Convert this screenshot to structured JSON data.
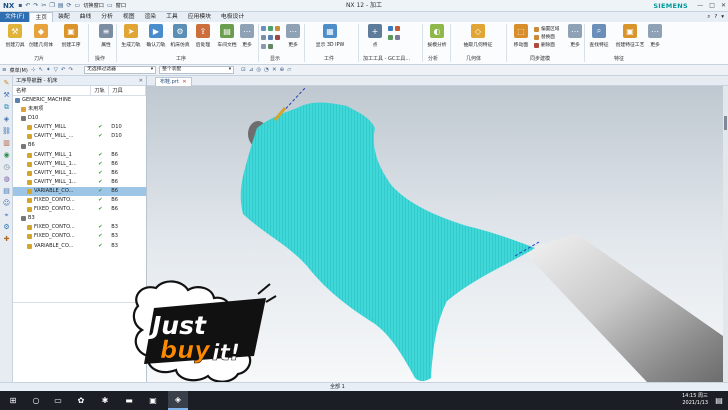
{
  "window": {
    "app_logo": "NX",
    "title": "NX 12 - 加工",
    "brand": "SIEMENS",
    "switch_window": "切换窗口",
    "window_menu": "窗口",
    "minimize": "—",
    "maximize": "□",
    "close": "✕"
  },
  "ribbon_tabs": [
    "文件(F)",
    "主页",
    "装配",
    "曲线",
    "分析",
    "视图",
    "渲染",
    "工具",
    "应用模块",
    "电极设计"
  ],
  "ribbon_groups": {
    "tool": "刀片",
    "operation": "操作",
    "process": "工序",
    "display": "显示",
    "workpiece": "工件",
    "machining_tool": "加工工具 - GC工具...",
    "analysis": "分析",
    "geometry": "几何体",
    "sync_modeling": "同步建模",
    "feature": "特征"
  },
  "ribbon_buttons": {
    "create_tool": "创建刀具",
    "create_geometry": "创建几何体",
    "create_operation": "创建工序",
    "properties": "属性",
    "generate_path": "生成刀轨",
    "confirm_path": "确认刀轨",
    "machine_sim": "机床仿真",
    "postprocess": "后处理",
    "shop_doc": "车间文档",
    "more1": "更多",
    "more2": "更多",
    "display_3d_ipw": "显示 3D IPW",
    "point": "点",
    "draft_analysis": "拔模分析",
    "extract_geometry": "抽取几何特征",
    "move_face": "移动面",
    "replace_face": "偏置区域",
    "replace_face2": "替换面",
    "delete_face": "删除面",
    "more3": "更多",
    "find_feature": "查找特征",
    "create_feature_process": "创建特征工艺",
    "more4": "更多"
  },
  "toolbar": {
    "menu": "菜单(M)",
    "filter": "无选择过滤器",
    "assembly_scope": "整个装配"
  },
  "navigator": {
    "title": "工序导航器 - 机床",
    "columns": [
      "名称",
      "刀轨",
      "刀具"
    ],
    "rows": [
      {
        "indent": 0,
        "name": "GENERIC_MACHINE",
        "path": "",
        "tool": "",
        "icon": "machine"
      },
      {
        "indent": 1,
        "name": "未用项",
        "path": "",
        "tool": "",
        "icon": "folder"
      },
      {
        "indent": 1,
        "name": "D10",
        "path": "",
        "tool": "",
        "icon": "tool"
      },
      {
        "indent": 2,
        "name": "CAVITY_MILL",
        "path": "✔",
        "tool": "D10",
        "icon": "op"
      },
      {
        "indent": 2,
        "name": "CAVITY_MILL_...",
        "path": "✔",
        "tool": "D10",
        "icon": "op"
      },
      {
        "indent": 1,
        "name": "B6",
        "path": "",
        "tool": "",
        "icon": "tool"
      },
      {
        "indent": 2,
        "name": "CAVITY_MILL_1",
        "path": "✔",
        "tool": "B6",
        "icon": "op"
      },
      {
        "indent": 2,
        "name": "CAVITY_MILL_1...",
        "path": "✔",
        "tool": "B6",
        "icon": "op"
      },
      {
        "indent": 2,
        "name": "CAVITY_MILL_1...",
        "path": "✔",
        "tool": "B6",
        "icon": "op"
      },
      {
        "indent": 2,
        "name": "CAVITY_MILL_1...",
        "path": "✔",
        "tool": "B6",
        "icon": "op"
      },
      {
        "indent": 2,
        "name": "VARIABLE_CO...",
        "path": "✔",
        "tool": "B6",
        "icon": "op",
        "selected": true
      },
      {
        "indent": 2,
        "name": "FIXED_CONTO...",
        "path": "✔",
        "tool": "B6",
        "icon": "op"
      },
      {
        "indent": 2,
        "name": "FIXED_CONTO...",
        "path": "✔",
        "tool": "B6",
        "icon": "op"
      },
      {
        "indent": 1,
        "name": "B3",
        "path": "",
        "tool": "",
        "icon": "tool"
      },
      {
        "indent": 2,
        "name": "FIXED_CONTO...",
        "path": "✔",
        "tool": "B3",
        "icon": "op"
      },
      {
        "indent": 2,
        "name": "FIXED_CONTO...",
        "path": "✔",
        "tool": "B3",
        "icon": "op"
      },
      {
        "indent": 2,
        "name": "VARIABLE_CO...",
        "path": "✔",
        "tool": "B3",
        "icon": "op"
      }
    ]
  },
  "graphics": {
    "tab_label": "布鞋.prt",
    "tab_close": "✕"
  },
  "status": {
    "center_text": "全部 1"
  },
  "sticker": {
    "line1": "Just",
    "line2": "buy",
    "line3": "it!"
  },
  "taskbar": {
    "time": "14:15 周三",
    "date": "2021/1/13"
  },
  "colors": {
    "toolpath": "#3fd8d8",
    "accent": "#2f6fb1",
    "sticker_orange": "#ff8a00"
  }
}
